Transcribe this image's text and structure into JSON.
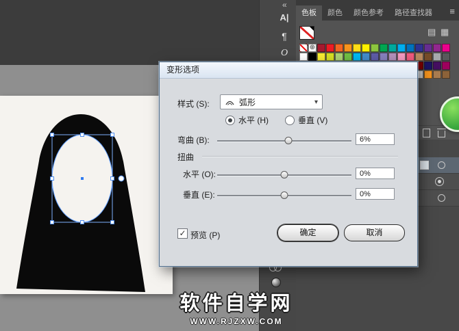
{
  "dock": {
    "collapse": "«",
    "items": [
      {
        "label": "A|"
      },
      {
        "label": "¶"
      },
      {
        "label": "O"
      }
    ]
  },
  "icons": {
    "menu": "≡",
    "list_view": "▤",
    "grid_view": "▦",
    "registration": "⊕",
    "check": "✓",
    "dropdown_arrow": "▾"
  },
  "panel_tabs": [
    {
      "label": "色板"
    },
    {
      "label": "颜色"
    },
    {
      "label": "颜色参考"
    },
    {
      "label": "路径查找器"
    }
  ],
  "swatches": {
    "rows": {
      "row1": [
        "none",
        "reg",
        "#a6192e",
        "#ed1c24",
        "#f26522",
        "#f7941d",
        "#ffde17",
        "#fff200",
        "#8dc63f",
        "#00a651",
        "#00a99d",
        "#00aeef",
        "#0072bc",
        "#2e3192",
        "#662d91",
        "#92278f",
        "#ec008c"
      ],
      "row2": [
        "#ffffff",
        "#000000",
        "#f9ed32",
        "#d7df23",
        "#acd373",
        "#71bf44",
        "#00b9f2",
        "#438ccb",
        "#5e5ca7",
        "#8781bd",
        "#b390bb",
        "#f49ac1",
        "#f05a7e",
        "#b98a5f",
        "#754c29",
        "#a7a9ac",
        "#58595b"
      ],
      "row3": [
        "#f26d7d",
        "#f68e55",
        "#fbaf5c",
        "#fff799",
        "#c4df9b",
        "#82ca9c",
        "#6dcff6",
        "#7da7d9",
        "#8781bd",
        "#a763a9",
        "#f49ac1",
        "#bd8cbf",
        "#7b0046",
        "#790000",
        "#1b1464",
        "#450e61",
        "#9e005d"
      ],
      "row4": [
        "#f7f7f7",
        "#e6e6e6",
        "#cccccc",
        "#b3b3b3",
        "#999999",
        "#808080",
        "#666666",
        "#4d4d4d",
        "#333333",
        "#1a1a1a",
        "#f9d8e7",
        "#d8e7f9",
        "#e8e8e8",
        "#cdcdcd",
        "#f7941d",
        "#a97c50",
        "#8c6239"
      ]
    }
  },
  "dialog": {
    "title": "变形选项",
    "style_label": "样式 (S):",
    "style_value": "弧形",
    "orientation": {
      "horizontal": "水平 (H)",
      "vertical": "垂直 (V)",
      "selected": "horizontal"
    },
    "bend": {
      "label": "弯曲 (B):",
      "value": "6%",
      "percent": 6
    },
    "distortion": {
      "label": "扭曲",
      "horizontal": {
        "label": "水平 (O):",
        "value": "0%",
        "percent": 0
      },
      "vertical": {
        "label": "垂直 (E):",
        "value": "0%",
        "percent": 0
      }
    },
    "preview": {
      "label": "预览 (P)",
      "checked": true
    },
    "buttons": {
      "ok": "确定",
      "cancel": "取消"
    }
  },
  "watermark": {
    "line1": "软件自学网",
    "line2": "WWW.RJZXW.COM"
  },
  "colors": {
    "selection_blue": "#4f8ef0",
    "artboard": "#f5f3ef",
    "hood_black": "#0a0a0a",
    "workspace_dark": "#3c3c3c",
    "pasteboard_gray": "#8f8f8f",
    "panel_gray": "#535353",
    "fab_green": "#3aa83e"
  }
}
